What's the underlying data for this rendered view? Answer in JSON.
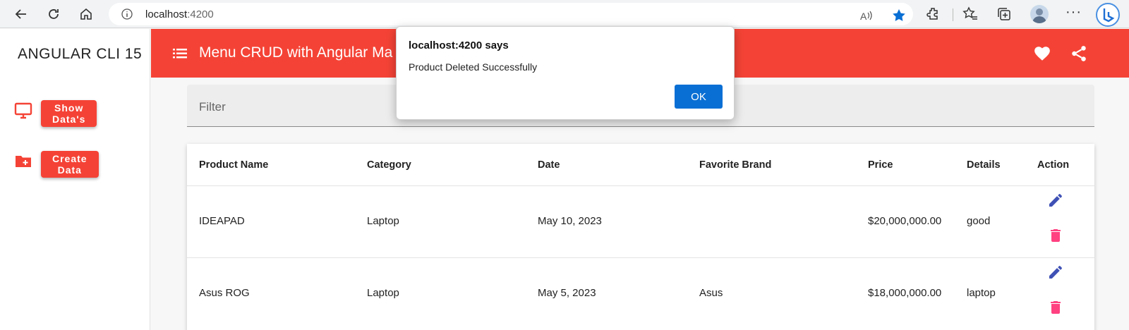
{
  "browser": {
    "url_host": "localhost",
    "url_port": ":4200"
  },
  "sidebar": {
    "brand": "ANGULAR CLI 15",
    "items": [
      {
        "label": "Show Data's",
        "icon": "monitor-icon"
      },
      {
        "label": "Create Data",
        "icon": "folder-add-icon"
      }
    ]
  },
  "topbar": {
    "title": "Menu CRUD with Angular Ma"
  },
  "filter": {
    "label": "Filter"
  },
  "table": {
    "headers": [
      "Product Name",
      "Category",
      "Date",
      "Favorite Brand",
      "Price",
      "Details",
      "Action"
    ],
    "rows": [
      {
        "name": "IDEAPAD",
        "category": "Laptop",
        "date": "May 10, 2023",
        "brand": "",
        "price": "$20,000,000.00",
        "details": "good"
      },
      {
        "name": "Asus ROG",
        "category": "Laptop",
        "date": "May 5, 2023",
        "brand": "Asus",
        "price": "$18,000,000.00",
        "details": "laptop"
      }
    ]
  },
  "dialog": {
    "title": "localhost:4200 says",
    "message": "Product Deleted Successfully",
    "ok_label": "OK"
  },
  "colors": {
    "primary": "#f44336",
    "edit": "#3f51b5",
    "delete": "#ff4081",
    "dialog_button": "#0a6fd4"
  }
}
